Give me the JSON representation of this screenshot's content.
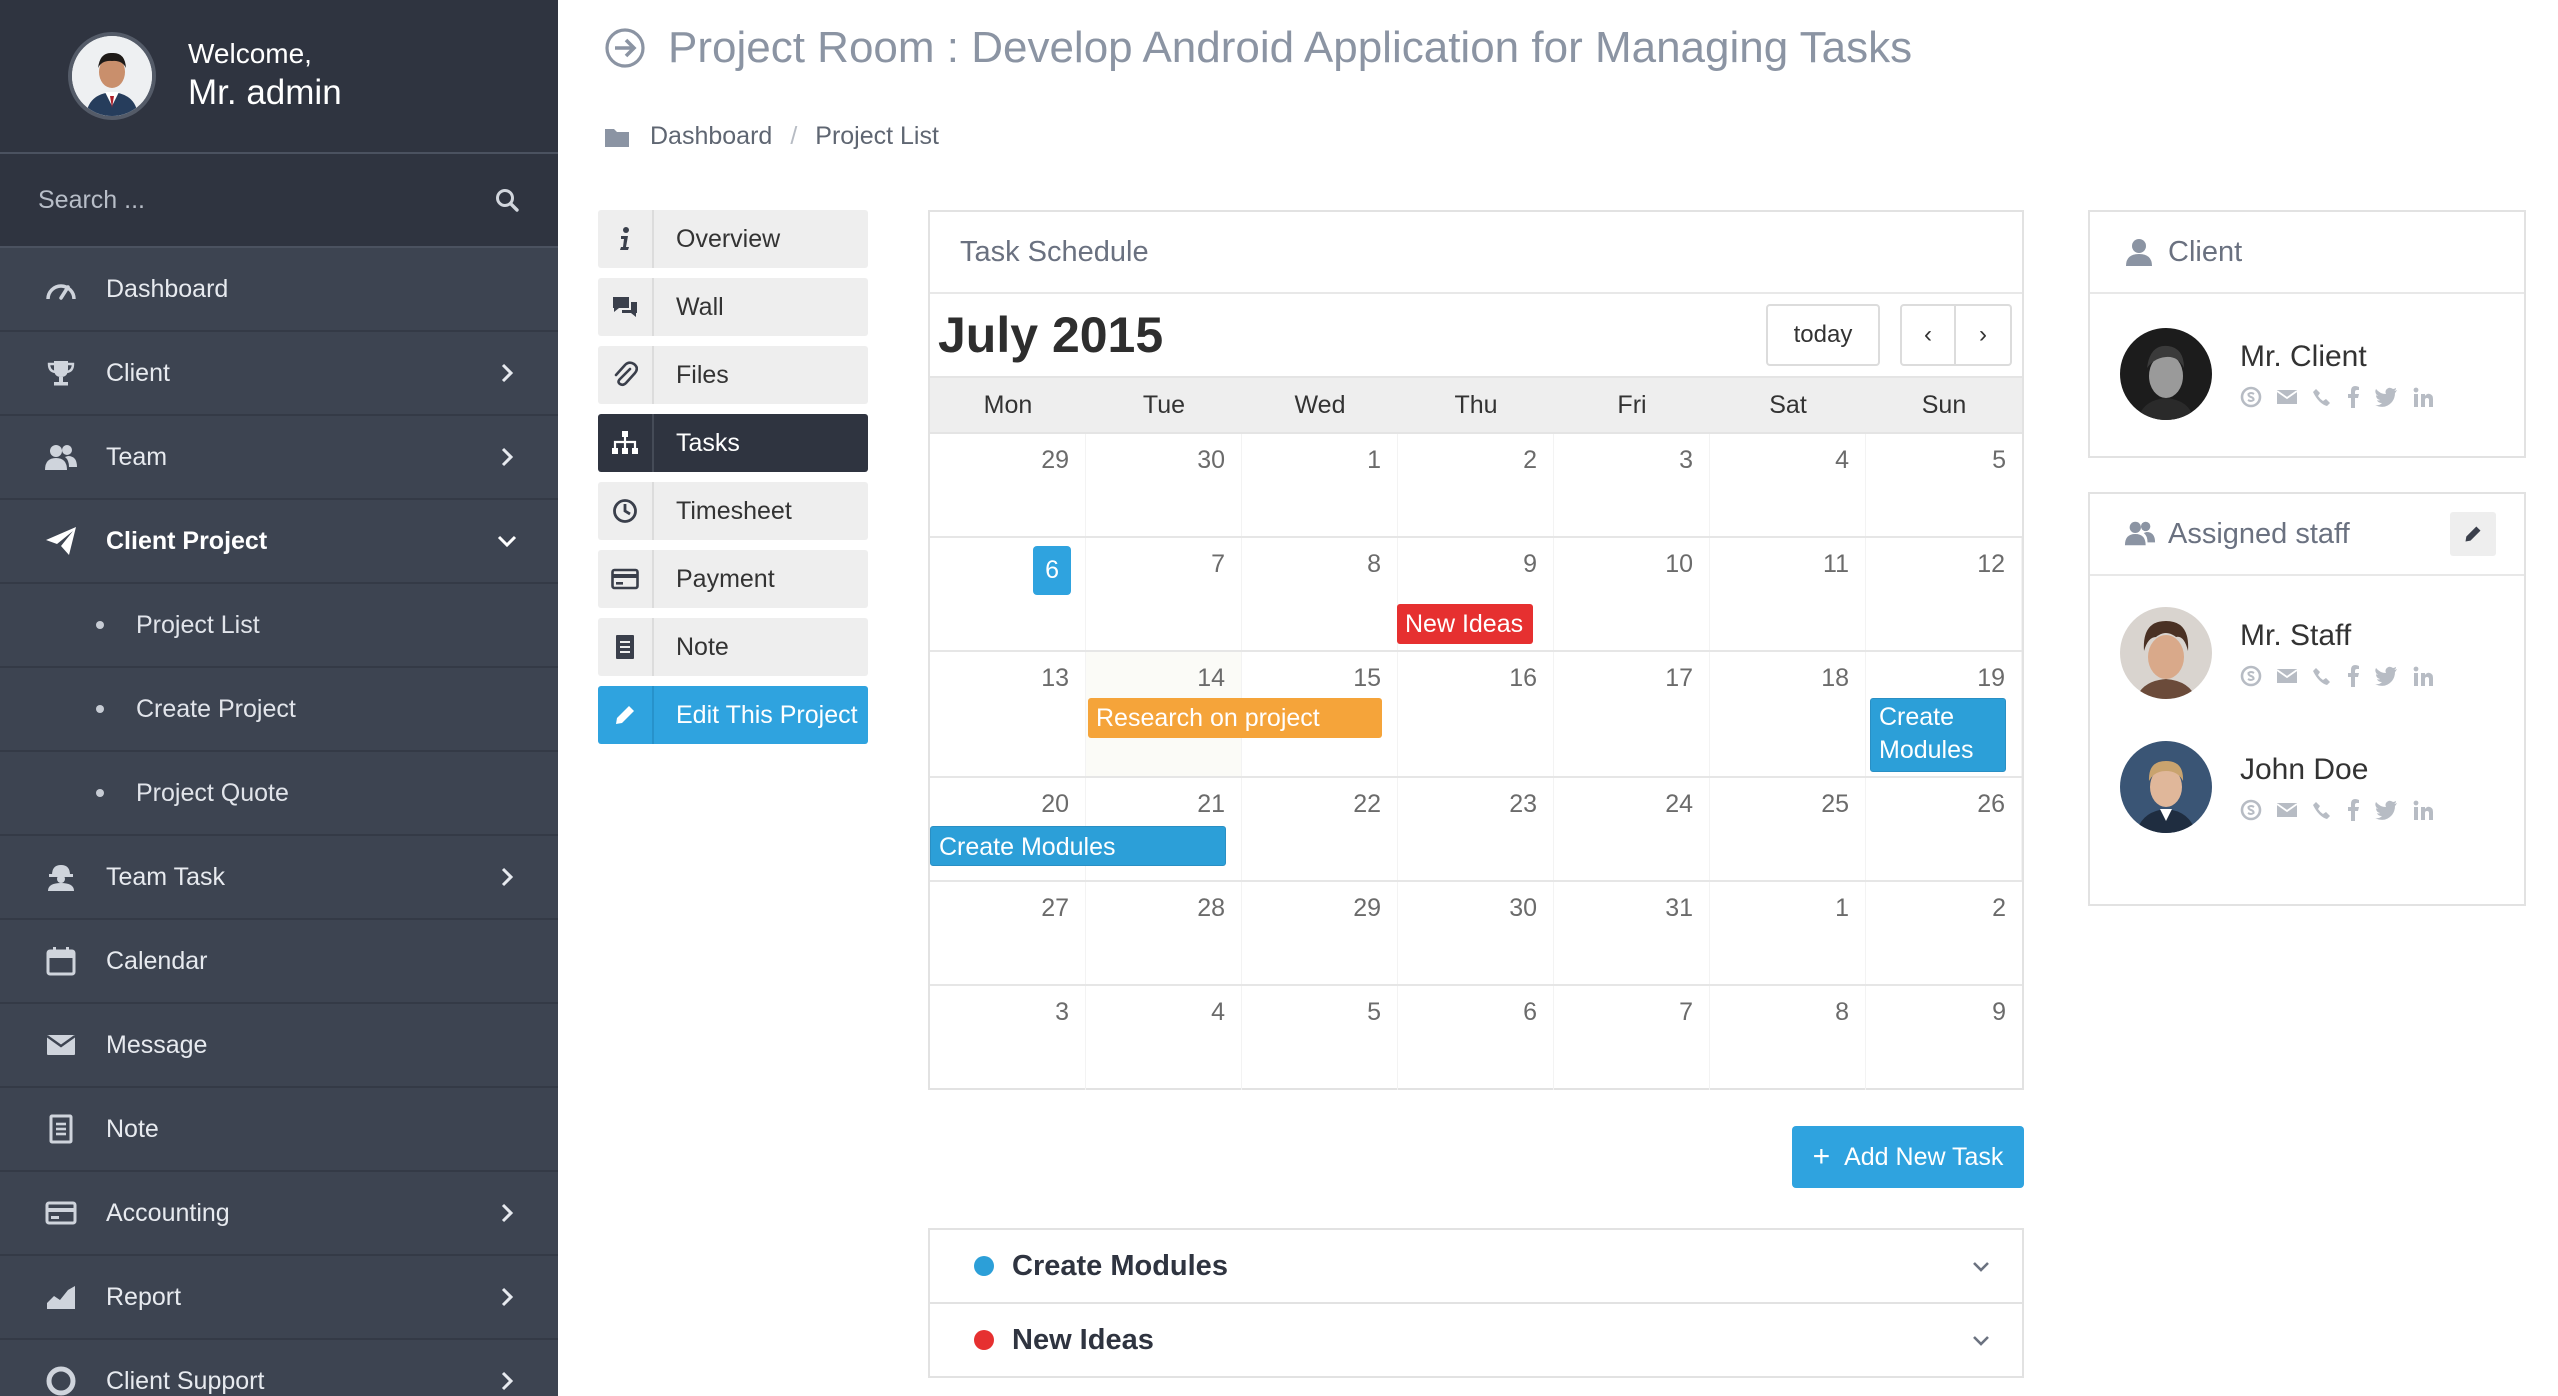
{
  "sidebar": {
    "welcome": "Welcome,",
    "user_name": "Mr. admin",
    "search_placeholder": "Search ...",
    "items": [
      {
        "label": "Dashboard",
        "icon": "dashboard-gauge-icon"
      },
      {
        "label": "Client",
        "icon": "trophy-icon"
      },
      {
        "label": "Team",
        "icon": "users-icon"
      },
      {
        "label": "Client Project",
        "icon": "paper-plane-icon",
        "active": true
      },
      {
        "label": "Project List"
      },
      {
        "label": "Create Project"
      },
      {
        "label": "Project Quote"
      },
      {
        "label": "Team Task",
        "icon": "worker-icon"
      },
      {
        "label": "Calendar",
        "icon": "calendar-icon"
      },
      {
        "label": "Message",
        "icon": "envelope-icon"
      },
      {
        "label": "Note",
        "icon": "note-icon"
      },
      {
        "label": "Accounting",
        "icon": "credit-card-icon"
      },
      {
        "label": "Report",
        "icon": "area-chart-icon"
      },
      {
        "label": "Client Support",
        "icon": "lifebuoy-icon"
      }
    ]
  },
  "header": {
    "title": "Project Room : Develop Android Application for Managing Tasks",
    "breadcrumb": [
      "Dashboard",
      "Project List"
    ]
  },
  "project_menu": [
    {
      "label": "Overview",
      "icon": "info-icon"
    },
    {
      "label": "Wall",
      "icon": "comments-icon"
    },
    {
      "label": "Files",
      "icon": "paperclip-icon"
    },
    {
      "label": "Tasks",
      "icon": "sitemap-icon",
      "active": true
    },
    {
      "label": "Timesheet",
      "icon": "clock-icon"
    },
    {
      "label": "Payment",
      "icon": "credit-card-icon"
    },
    {
      "label": "Note",
      "icon": "note-icon"
    },
    {
      "label": "Edit This Project",
      "icon": "pencil-icon"
    }
  ],
  "calendar": {
    "panel_title": "Task Schedule",
    "month": "July 2015",
    "today_label": "today",
    "prev_label": "‹",
    "next_label": "›",
    "days_of_week": [
      "Mon",
      "Tue",
      "Wed",
      "Thu",
      "Fri",
      "Sat",
      "Sun"
    ],
    "weeks": [
      [
        "29",
        "30",
        "1",
        "2",
        "3",
        "4",
        "5"
      ],
      [
        "6",
        "7",
        "8",
        "9",
        "10",
        "11",
        "12"
      ],
      [
        "13",
        "14",
        "15",
        "16",
        "17",
        "18",
        "19"
      ],
      [
        "20",
        "21",
        "22",
        "23",
        "24",
        "25",
        "26"
      ],
      [
        "27",
        "28",
        "29",
        "30",
        "31",
        "1",
        "2"
      ],
      [
        "3",
        "4",
        "5",
        "6",
        "7",
        "8",
        "9"
      ]
    ],
    "today": "6",
    "events": [
      {
        "title": "New Ideas",
        "date": "2015-07-09",
        "color": "#e63030"
      },
      {
        "title": "Research on project",
        "start": "2015-07-14",
        "end": "2015-07-15",
        "color": "#f5a43a"
      },
      {
        "title": "Create Modules",
        "date": "2015-07-19",
        "color": "#2c9fd8"
      },
      {
        "title": "Create Modules",
        "start": "2015-07-20",
        "end": "2015-07-21",
        "color": "#2c9fd8"
      }
    ]
  },
  "add_task_label": "Add New Task",
  "tasks": [
    {
      "label": "Create Modules",
      "color": "#2c9fd8"
    },
    {
      "label": "New Ideas",
      "color": "#e63030"
    }
  ],
  "client_panel": {
    "title": "Client",
    "name": "Mr. Client"
  },
  "staff_panel": {
    "title": "Assigned staff",
    "members": [
      {
        "name": "Mr. Staff"
      },
      {
        "name": "John Doe"
      }
    ]
  },
  "social_icons": [
    "skype-icon",
    "envelope-icon",
    "phone-icon",
    "facebook-icon",
    "twitter-icon",
    "linkedin-icon"
  ],
  "colors": {
    "sidebar_bg": "#3d4451",
    "sidebar_dark": "#2f3440",
    "accent_blue": "#2fa3df",
    "event_red": "#e63030",
    "event_orange": "#f5a43a"
  }
}
